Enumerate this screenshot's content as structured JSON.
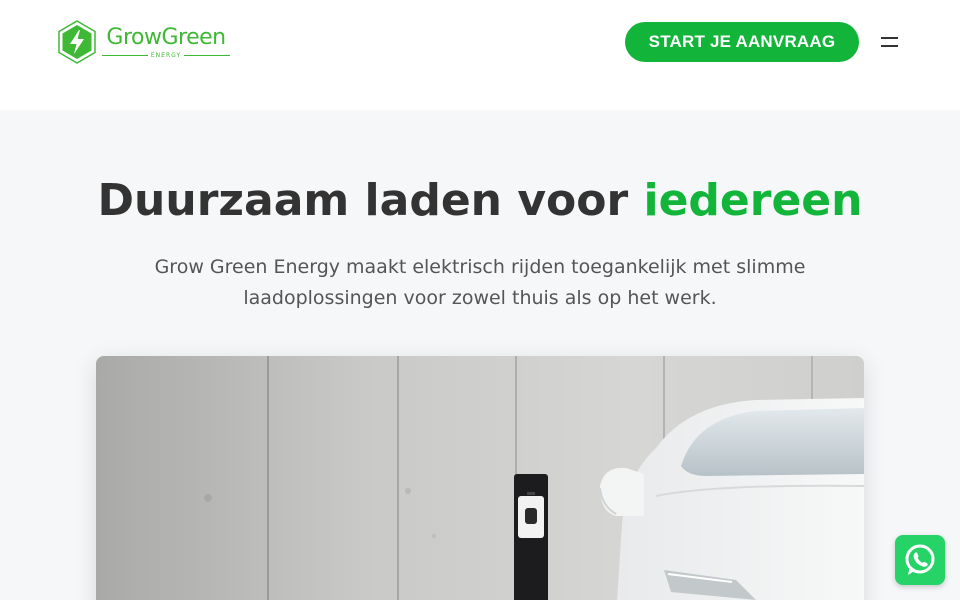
{
  "header": {
    "logo": {
      "name": "GrowGreen",
      "sub": "ENERGY"
    },
    "cta_label": "START JE AANVRAAG",
    "menu_icon": "hamburger-menu-icon"
  },
  "hero": {
    "title_main": "Duurzaam laden voor ",
    "title_accent": "iedereen",
    "subtitle": "Grow Green Energy maakt elektrisch rijden toegankelijk met slimme laadoplossingen voor zowel thuis als op het werk.",
    "image_alt": "wall-mounted EV charging station next to a white electric car"
  },
  "floating": {
    "whatsapp_icon": "whatsapp-icon"
  },
  "colors": {
    "accent": "#12b53a",
    "logo_green": "#3fb935",
    "heading": "#333333",
    "body_text": "#555555",
    "hero_bg": "#f5f7f9",
    "whatsapp": "#25d366"
  }
}
